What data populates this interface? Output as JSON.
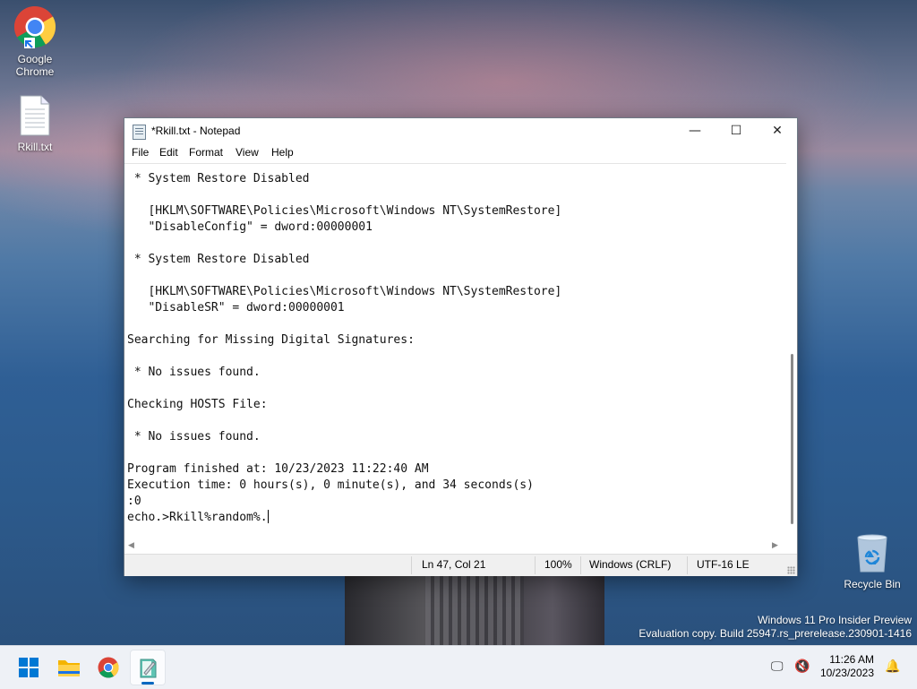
{
  "desktop": {
    "icons": [
      {
        "label_line1": "Google",
        "label_line2": "Chrome",
        "icon": "chrome-icon"
      },
      {
        "label": "Rkill.txt",
        "icon": "text-file-icon"
      },
      {
        "label": "Recycle Bin",
        "icon": "recycle-bin-icon"
      }
    ],
    "watermark": {
      "line1": "Windows 11 Pro Insider Preview",
      "line2": "Evaluation copy. Build 25947.rs_prerelease.230901-1416"
    }
  },
  "window": {
    "title": "*Rkill.txt - Notepad",
    "controls": {
      "minimize": "—",
      "maximize": "☐",
      "close": "✕"
    },
    "menu": [
      "File",
      "Edit",
      "Format",
      "View",
      "Help"
    ],
    "content_lines": [
      "",
      " * System Restore Disabled",
      "",
      "   [HKLM\\SOFTWARE\\Policies\\Microsoft\\Windows NT\\SystemRestore]",
      "   \"DisableConfig\" = dword:00000001",
      "",
      " * System Restore Disabled",
      "",
      "   [HKLM\\SOFTWARE\\Policies\\Microsoft\\Windows NT\\SystemRestore]",
      "   \"DisableSR\" = dword:00000001",
      "",
      "Searching for Missing Digital Signatures:",
      "",
      " * No issues found.",
      "",
      "Checking HOSTS File:",
      "",
      " * No issues found.",
      "",
      "Program finished at: 10/23/2023 11:22:40 AM",
      "Execution time: 0 hours(s), 0 minute(s), and 34 seconds(s)",
      ":0",
      "echo.>Rkill%random%."
    ],
    "status": {
      "position": "Ln 47, Col 21",
      "zoom": "100%",
      "line_ending": "Windows (CRLF)",
      "encoding": "UTF-16 LE"
    }
  },
  "taskbar": {
    "buttons": [
      {
        "name": "start-button",
        "icon": "windows-logo-icon"
      },
      {
        "name": "file-explorer-button",
        "icon": "folder-icon"
      },
      {
        "name": "chrome-taskbar-button",
        "icon": "chrome-icon"
      },
      {
        "name": "notepad-taskbar-button",
        "icon": "notepad-icon",
        "active": true
      }
    ],
    "clock": {
      "time": "11:26 AM",
      "date": "10/23/2023"
    }
  },
  "colors": {
    "accent": "#0067c0",
    "statusbar": "#f0f0f0"
  }
}
